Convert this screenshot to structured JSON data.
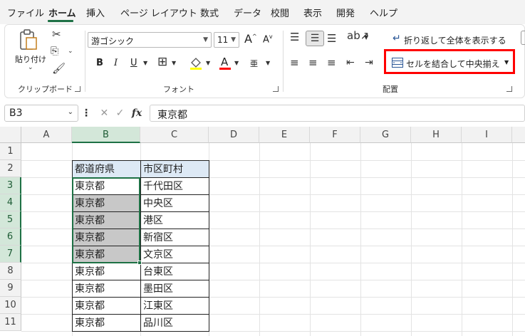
{
  "menu": {
    "tabs": [
      {
        "label": "ファイル"
      },
      {
        "label": "ホーム"
      },
      {
        "label": "挿入"
      },
      {
        "label": "ページ レイアウト"
      },
      {
        "label": "数式"
      },
      {
        "label": "データ"
      },
      {
        "label": "校閲"
      },
      {
        "label": "表示"
      },
      {
        "label": "開発"
      },
      {
        "label": "ヘルプ"
      }
    ],
    "active_tab": "ホーム"
  },
  "ribbon": {
    "clipboard": {
      "paste_label": "貼り付け",
      "group_label": "クリップボード"
    },
    "font": {
      "font_name": "游ゴシック",
      "font_size": "11",
      "bold": "B",
      "italic": "I",
      "underline": "U",
      "grow": "A",
      "shrink": "A",
      "font_color_glyph": "A",
      "phonetic_glyph": "亜",
      "group_label": "フォント"
    },
    "alignment": {
      "wrap_text": "折り返して全体を表示する",
      "merge_center": "セルを結合して中央揃え",
      "group_label": "配置"
    },
    "accent_color": "#ff0000"
  },
  "formula_bar": {
    "name_box": "B3",
    "fx": "fx",
    "content": "東京都"
  },
  "grid": {
    "columns": [
      "A",
      "B",
      "C",
      "D",
      "E",
      "F",
      "G",
      "H",
      "I"
    ],
    "rows": [
      "1",
      "2",
      "3",
      "4",
      "5",
      "6",
      "7",
      "8",
      "9",
      "10",
      "11"
    ],
    "table": {
      "header": [
        "都道府県",
        "市区町村"
      ],
      "rows": [
        [
          "東京都",
          "千代田区"
        ],
        [
          "東京都",
          "中央区"
        ],
        [
          "東京都",
          "港区"
        ],
        [
          "東京都",
          "新宿区"
        ],
        [
          "東京都",
          "文京区"
        ],
        [
          "東京都",
          "台東区"
        ],
        [
          "東京都",
          "墨田区"
        ],
        [
          "東京都",
          "江東区"
        ],
        [
          "東京都",
          "品川区"
        ]
      ]
    },
    "selected_cell": "B3",
    "selection_color": "#1e7145"
  }
}
